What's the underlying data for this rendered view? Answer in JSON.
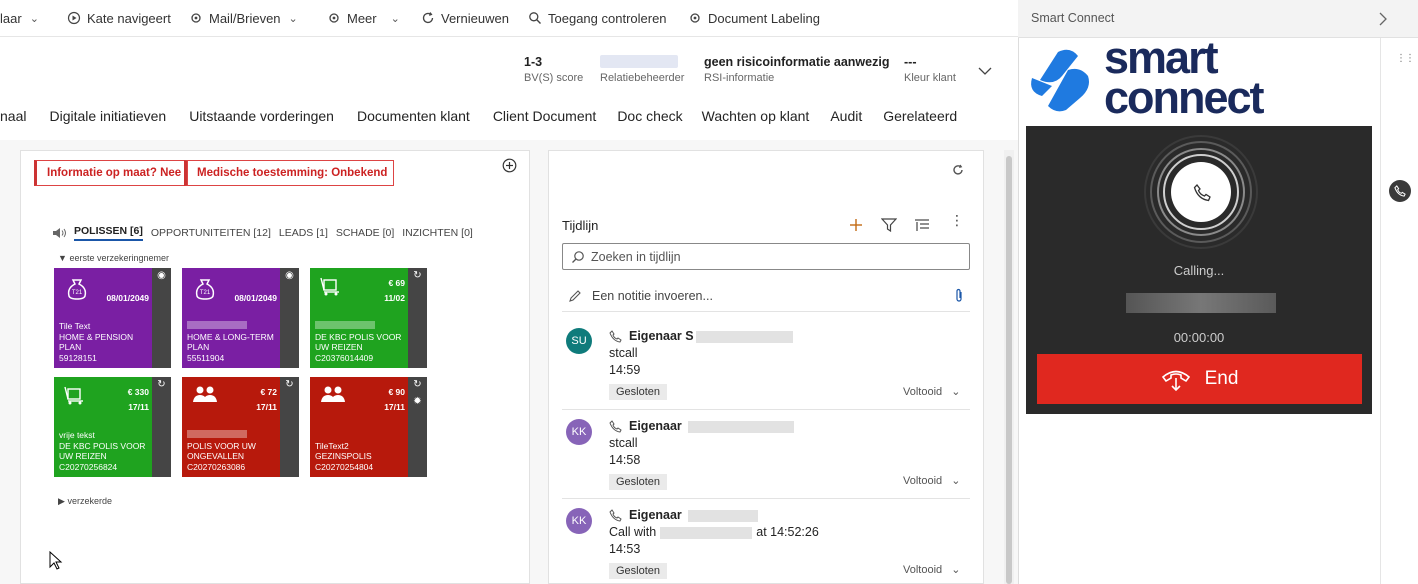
{
  "command_bar": {
    "items": [
      {
        "label": "laar",
        "icon": "none"
      },
      {
        "label": "Kate navigeert",
        "icon": "play-circle-icon"
      },
      {
        "label": "Mail/Brieven",
        "icon": "gear-flow-icon"
      },
      {
        "label": "Meer",
        "icon": "gear-flow-icon"
      },
      {
        "label": "Vernieuwen",
        "icon": "refresh-icon"
      },
      {
        "label": "Toegang controleren",
        "icon": "search-icon"
      },
      {
        "label": "Document Labeling",
        "icon": "gear-flow-icon"
      }
    ]
  },
  "header": {
    "fields": [
      {
        "value": "1-3",
        "label": "BV(S) score"
      },
      {
        "value": "",
        "label": "Relatiebeheerder"
      },
      {
        "value": "geen risicoinformatie aanwezig",
        "label": "RSI-informatie"
      },
      {
        "value": "---",
        "label": "Kleur klant"
      }
    ]
  },
  "tabs": [
    "naal",
    "Digitale initiatieven",
    "Uitstaande vorderingen",
    "Documenten klant",
    "Client Document",
    "Doc check",
    "Wachten op klant",
    "Audit",
    "Gerelateerd"
  ],
  "tags": [
    "Informatie op maat? Nee",
    "Medische toestemming: Onbekend"
  ],
  "product_tabs": [
    {
      "label": "POLISSEN [6]",
      "active": true
    },
    {
      "label": "OPPORTUNITEITEN [12]",
      "active": false
    },
    {
      "label": "LEADS [1]",
      "active": false
    },
    {
      "label": "SCHADE [0]",
      "active": false
    },
    {
      "label": "INZICHTEN [0]",
      "active": false
    }
  ],
  "group_first": "eerste verzekeringnemer",
  "group_second": "verzekerde",
  "tiles": [
    {
      "color": "#7a1fa3",
      "top_right": "08/01/2049",
      "amount": "",
      "lines": [
        "Tile Text",
        "HOME & PENSION",
        "PLAN",
        "59128151"
      ],
      "icon": "money-bag-icon",
      "side": "eye-icon"
    },
    {
      "color": "#7a1fa3",
      "top_right": "08/01/2049",
      "amount": "",
      "lines": [
        "",
        "HOME & LONG-TERM",
        "PLAN",
        "55511904"
      ],
      "icon": "money-bag-icon",
      "side": "eye-icon"
    },
    {
      "color": "#1fa31f",
      "top_right": "11/02",
      "amount": "€ 69",
      "lines": [
        "",
        "DE KBC POLIS VOOR",
        "UW REIZEN",
        "C20376014409"
      ],
      "icon": "luggage-cart-icon",
      "side": "refresh-icon"
    },
    {
      "color": "#1fa31f",
      "top_right": "17/11",
      "amount": "€ 330",
      "lines": [
        "vrije tekst",
        "DE KBC POLIS VOOR",
        "UW REIZEN",
        "C20270256824"
      ],
      "icon": "luggage-cart-icon",
      "side": "refresh-icon"
    },
    {
      "color": "#b7190c",
      "top_right": "17/11",
      "amount": "€ 72",
      "lines": [
        "",
        "POLIS VOOR UW",
        "ONGEVALLEN",
        "C20270263086"
      ],
      "icon": "people-icon",
      "side": "refresh-icon"
    },
    {
      "color": "#b7190c",
      "top_right": "17/11",
      "amount": "€ 90",
      "lines": [
        "TileText2",
        "GEZINSPOLIS",
        "C20270254804"
      ],
      "icon": "people-icon",
      "side": "refresh-icon"
    }
  ],
  "timeline": {
    "title": "Tijdlijn",
    "search_placeholder": "Zoeken in tijdlijn",
    "note_placeholder": "Een notitie invoeren...",
    "items": [
      {
        "initials": "SU",
        "avatar_color": "#0f7b7b",
        "title": "Eigenaar S",
        "line1": "stcall",
        "time": "14:59",
        "badge": "Gesloten",
        "status": "Voltooid"
      },
      {
        "initials": "KK",
        "avatar_color": "#8764b8",
        "title": "Eigenaar",
        "line1": "stcall",
        "time": "14:58",
        "badge": "Gesloten",
        "status": "Voltooid"
      },
      {
        "initials": "KK",
        "avatar_color": "#8764b8",
        "title": "Eigenaar",
        "line1": "Call with",
        "line1_suffix": "at 14:52:26",
        "time": "14:53",
        "badge": "Gesloten",
        "status": "Voltooid"
      }
    ]
  },
  "smart_connect": {
    "title": "Smart Connect",
    "logo_line1": "smart",
    "logo_line2": "connect",
    "calling": "Calling...",
    "timer": "00:00:00",
    "end_label": "End",
    "brand_blue": "#1f7ae0",
    "brand_navy": "#1a2a5c",
    "end_red": "#e0281f"
  }
}
